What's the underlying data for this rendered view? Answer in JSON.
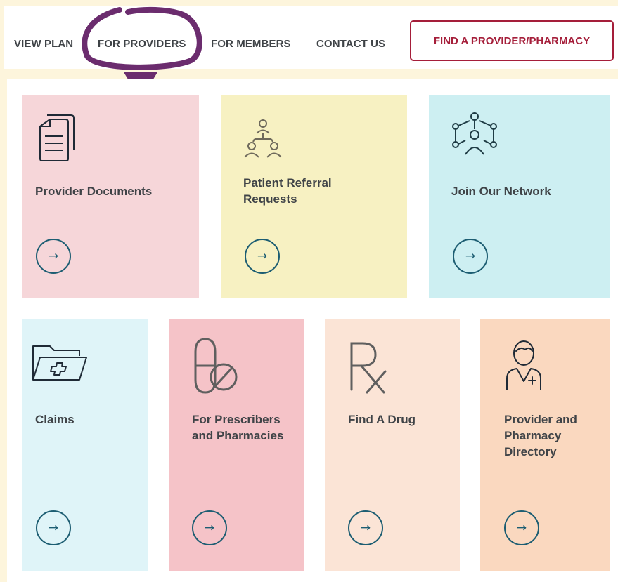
{
  "nav": {
    "links": [
      "VIEW PLAN",
      "FOR PROVIDERS",
      "FOR MEMBERS",
      "CONTACT US"
    ],
    "cta": "FIND A PROVIDER/PHARMACY"
  },
  "colors": {
    "nav_text": "#3f4347",
    "cta": "#a51e3a",
    "annotation": "#6b2c6e",
    "arrow": "#1c5d72"
  },
  "cards": [
    {
      "title": "Provider Documents",
      "icon": "documents-icon",
      "color": "#f6d6d9"
    },
    {
      "title": "Patient Referral Requests",
      "icon": "referral-people-icon",
      "color": "#f7f1c2"
    },
    {
      "title": "Join Our Network",
      "icon": "network-icon",
      "color": "#cdeff2"
    },
    {
      "title": "Claims",
      "icon": "folder-plus-icon",
      "color": "#dff4f8"
    },
    {
      "title": "For Prescribers and Pharmacies",
      "icon": "pill-block-icon",
      "color": "#f5c3c8"
    },
    {
      "title": "Find A Drug",
      "icon": "rx-icon",
      "color": "#fbe4d6"
    },
    {
      "title": "Provider and Pharmacy Directory",
      "icon": "doctor-icon",
      "color": "#fad8bf"
    }
  ],
  "arrow_glyph": "→"
}
